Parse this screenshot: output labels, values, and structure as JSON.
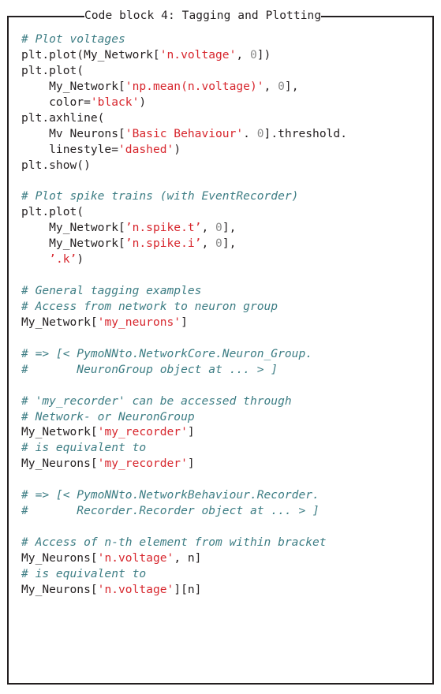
{
  "caption": "Code block 4: Tagging and Plotting",
  "colors": {
    "text": "#231f20",
    "comment": "#3d7d84",
    "string": "#d7262d",
    "number": "#8a8a8a",
    "border": "#231f20",
    "background": "#ffffff"
  },
  "code": {
    "language": "python",
    "lines": [
      [
        {
          "t": "# Plot voltages",
          "c": "comment"
        }
      ],
      [
        {
          "t": "plt.plot(My_Network[",
          "c": "plain"
        },
        {
          "t": "'n.voltage'",
          "c": "string"
        },
        {
          "t": ", ",
          "c": "plain"
        },
        {
          "t": "0",
          "c": "number"
        },
        {
          "t": "])",
          "c": "plain"
        }
      ],
      [
        {
          "t": "plt.plot(",
          "c": "plain"
        }
      ],
      [
        {
          "t": "    My_Network[",
          "c": "plain"
        },
        {
          "t": "'np.mean(n.voltage)'",
          "c": "string"
        },
        {
          "t": ", ",
          "c": "plain"
        },
        {
          "t": "0",
          "c": "number"
        },
        {
          "t": "],",
          "c": "plain"
        }
      ],
      [
        {
          "t": "    color=",
          "c": "plain"
        },
        {
          "t": "'black'",
          "c": "string"
        },
        {
          "t": ")",
          "c": "plain"
        }
      ],
      [
        {
          "t": "plt.axhline(",
          "c": "plain"
        }
      ],
      [
        {
          "t": "    Mv Neurons[",
          "c": "plain"
        },
        {
          "t": "'Basic Behaviour'",
          "c": "string"
        },
        {
          "t": ". ",
          "c": "plain"
        },
        {
          "t": "0",
          "c": "number"
        },
        {
          "t": "].threshold.",
          "c": "plain"
        }
      ],
      [
        {
          "t": "    linestyle=",
          "c": "plain"
        },
        {
          "t": "'dashed'",
          "c": "string"
        },
        {
          "t": ")",
          "c": "plain"
        }
      ],
      [
        {
          "t": "plt.show()",
          "c": "plain"
        }
      ],
      [
        {
          "t": "",
          "c": "blank"
        }
      ],
      [
        {
          "t": "# Plot spike trains (with EventRecorder)",
          "c": "comment"
        }
      ],
      [
        {
          "t": "plt.plot(",
          "c": "plain"
        }
      ],
      [
        {
          "t": "    My_Network[",
          "c": "plain"
        },
        {
          "t": "’n.spike.t’",
          "c": "string"
        },
        {
          "t": ", ",
          "c": "plain"
        },
        {
          "t": "0",
          "c": "number"
        },
        {
          "t": "],",
          "c": "plain"
        }
      ],
      [
        {
          "t": "    My_Network[",
          "c": "plain"
        },
        {
          "t": "’n.spike.i’",
          "c": "string"
        },
        {
          "t": ", ",
          "c": "plain"
        },
        {
          "t": "0",
          "c": "number"
        },
        {
          "t": "],",
          "c": "plain"
        }
      ],
      [
        {
          "t": "    ",
          "c": "plain"
        },
        {
          "t": "’.k’",
          "c": "string"
        },
        {
          "t": ")",
          "c": "plain"
        }
      ],
      [
        {
          "t": "",
          "c": "blank"
        }
      ],
      [
        {
          "t": "# General tagging examples",
          "c": "comment"
        }
      ],
      [
        {
          "t": "# Access from network to neuron group",
          "c": "comment"
        }
      ],
      [
        {
          "t": "My_Network[",
          "c": "plain"
        },
        {
          "t": "'my_neurons'",
          "c": "string"
        },
        {
          "t": "]",
          "c": "plain"
        }
      ],
      [
        {
          "t": "",
          "c": "blank"
        }
      ],
      [
        {
          "t": "# => [< PymoNNto.NetworkCore.Neuron_Group.",
          "c": "comment"
        }
      ],
      [
        {
          "t": "#       NeuronGroup object at ... > ]",
          "c": "comment"
        }
      ],
      [
        {
          "t": "",
          "c": "blank"
        }
      ],
      [
        {
          "t": "# 'my_recorder' can be accessed through",
          "c": "comment"
        }
      ],
      [
        {
          "t": "# Network- or NeuronGroup",
          "c": "comment"
        }
      ],
      [
        {
          "t": "My_Network[",
          "c": "plain"
        },
        {
          "t": "'my_recorder'",
          "c": "string"
        },
        {
          "t": "]",
          "c": "plain"
        }
      ],
      [
        {
          "t": "# is equivalent to",
          "c": "comment"
        }
      ],
      [
        {
          "t": "My_Neurons[",
          "c": "plain"
        },
        {
          "t": "'my_recorder'",
          "c": "string"
        },
        {
          "t": "]",
          "c": "plain"
        }
      ],
      [
        {
          "t": "",
          "c": "blank"
        }
      ],
      [
        {
          "t": "# => [< PymoNNto.NetworkBehaviour.Recorder.",
          "c": "comment"
        }
      ],
      [
        {
          "t": "#       Recorder.Recorder object at ... > ]",
          "c": "comment"
        }
      ],
      [
        {
          "t": "",
          "c": "blank"
        }
      ],
      [
        {
          "t": "# Access of n-th element from within bracket",
          "c": "comment"
        }
      ],
      [
        {
          "t": "My_Neurons[",
          "c": "plain"
        },
        {
          "t": "'n.voltage'",
          "c": "string"
        },
        {
          "t": ", n]",
          "c": "plain"
        }
      ],
      [
        {
          "t": "# is equivalent to",
          "c": "comment"
        }
      ],
      [
        {
          "t": "My_Neurons[",
          "c": "plain"
        },
        {
          "t": "'n.voltage'",
          "c": "string"
        },
        {
          "t": "][n]",
          "c": "plain"
        }
      ]
    ]
  }
}
